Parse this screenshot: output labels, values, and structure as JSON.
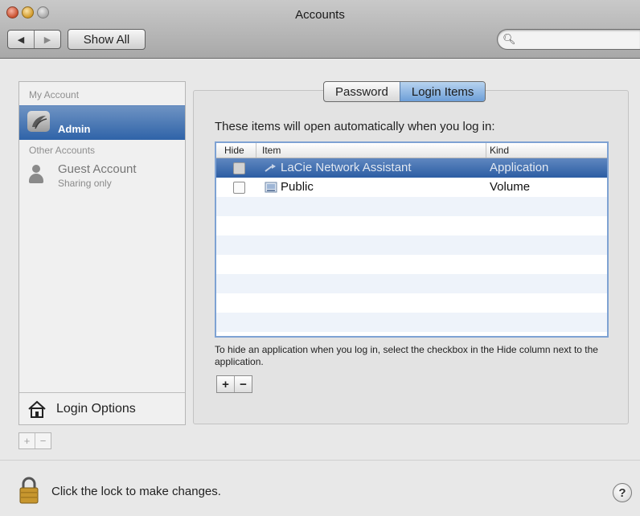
{
  "window": {
    "title": "Accounts"
  },
  "toolbar": {
    "back_icon": "back-arrow-icon",
    "forward_icon": "forward-arrow-icon",
    "show_all_label": "Show All",
    "search_value": "",
    "search_icon": "magnifier-icon"
  },
  "sidebar": {
    "my_account_header": "My Account",
    "current_user": {
      "name": "Admin",
      "icon": "user-avatar-icon"
    },
    "other_accounts_header": "Other Accounts",
    "other_accounts": [
      {
        "name": "Guest Account",
        "subtitle": "Sharing only",
        "icon": "person-silhouette-icon"
      }
    ],
    "login_options_label": "Login Options",
    "add_label": "+",
    "remove_label": "−"
  },
  "tabs": [
    {
      "label": "Password",
      "active": false
    },
    {
      "label": "Login Items",
      "active": true
    }
  ],
  "login_items": {
    "intro": "These items will open automatically when you log in:",
    "columns": [
      "Hide",
      "Item",
      "Kind"
    ],
    "rows": [
      {
        "hide": false,
        "item": "LaCie Network Assistant",
        "kind": "Application",
        "selected": true
      },
      {
        "hide": false,
        "item": "Public",
        "kind": "Volume",
        "selected": false,
        "highlighted": true
      }
    ],
    "hint": "To hide an application when you log in, select the checkbox in the Hide column next to the application.",
    "add_label": "+",
    "remove_label": "−"
  },
  "footer": {
    "lock_text": "Click the lock to make changes.",
    "help_label": "?"
  },
  "colors": {
    "selection": "#2f63a8",
    "table_border": "#7ea2d3"
  }
}
